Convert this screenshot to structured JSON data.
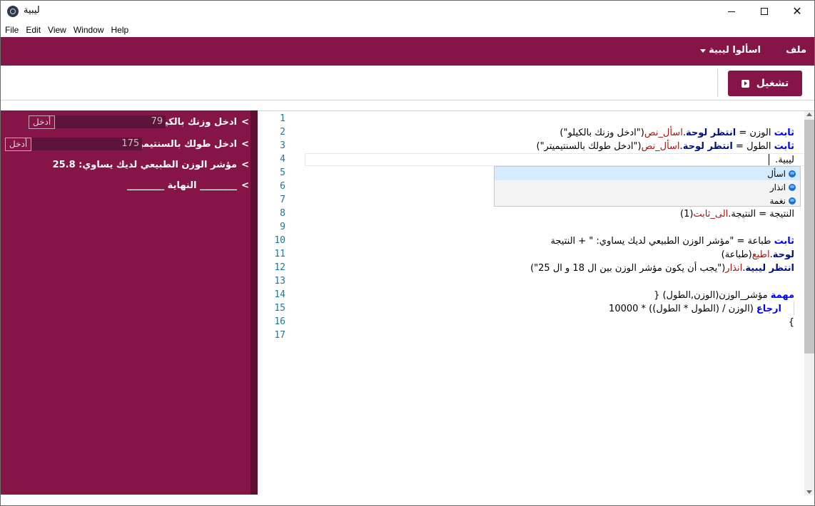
{
  "window": {
    "title": "ليبية"
  },
  "menubar": [
    "File",
    "Edit",
    "View",
    "Window",
    "Help"
  ],
  "header": {
    "file_label": "ملف",
    "ask_label": "اسألوا ليبية"
  },
  "toolbar": {
    "run_label": "تشغيل"
  },
  "output": {
    "lines": [
      {
        "label": "ادخل وزنك بالكيلو:",
        "input_value": "79",
        "button": "أدخل"
      },
      {
        "label": "ادخل طولك بالسنتيميتر:",
        "input_value": "175",
        "button": "أدخل"
      },
      {
        "text": "مؤشر الوزن الطبيعي لديك يساوي: 25.8"
      },
      {
        "text": "________ النهاية ________"
      }
    ],
    "prompt_glyph": ">"
  },
  "editor": {
    "line_numbers": [
      "1",
      "2",
      "3",
      "4",
      "5",
      "6",
      "7",
      "8",
      "9",
      "10",
      "11",
      "12",
      "13",
      "14",
      "15",
      "16",
      "17"
    ],
    "lines": {
      "l2": {
        "kw": "ثابت",
        "a": " الوزن = ",
        "b": "انتظر لوحة",
        "c": ".",
        "d": "اسأل_نص",
        "e": "(\"ادخل وزنك بالكيلو\")"
      },
      "l3": {
        "kw": "ثابت",
        "a": " الطول = ",
        "b": "انتظر لوحة",
        "c": ".",
        "d": "اسأل_نص",
        "e": "(\"ادخل طولك بالسنتيميتر\")"
      },
      "l4": {
        "text": "ليبية."
      },
      "l8": {
        "a": "النتيجة = النتيجة.",
        "d": "الى_ثابت",
        "e": "(1)"
      },
      "l10": {
        "kw": "ثابت",
        "a": " طباعة = \"مؤشر الوزن الطبيعي لديك يساوي: \" + النتيجة"
      },
      "l11": {
        "b": "لوحة",
        "c": ".",
        "d": "اطبع",
        "e": "(طباعة)"
      },
      "l12": {
        "b": "انتظر ليبية",
        "c": ".",
        "d": "انذار",
        "e": "(\"يجب أن يكون مؤشر الوزن بين ال 18 و ال 25\")"
      },
      "l14": {
        "kw": "مهمة",
        "a": " مؤشر_الوزن(الوزن,الطول) {"
      },
      "l15": {
        "kw": "ارجاع",
        "a": " (الوزن / (الطول * الطول)) * 10000"
      },
      "l16": {
        "a": "}"
      }
    },
    "suggestions": [
      "اسأل",
      "انذار",
      "نغمة"
    ]
  },
  "colors": {
    "accent": "#861547",
    "accent_dark": "#5c0f31"
  }
}
